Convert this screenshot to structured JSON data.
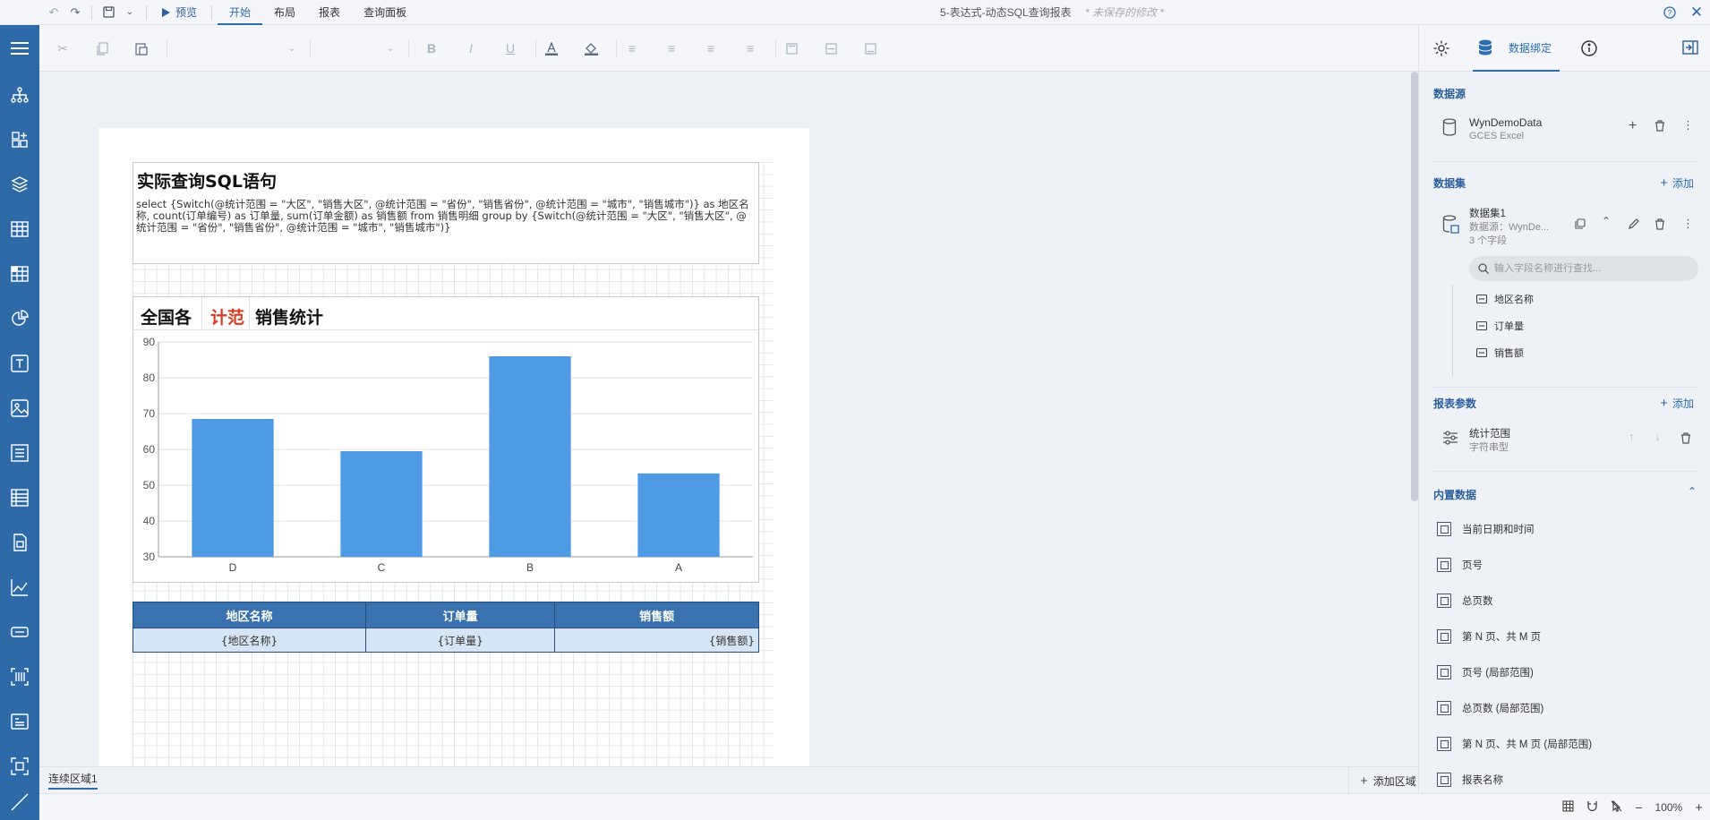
{
  "topbar": {
    "preview_label": "预览",
    "tabs": [
      {
        "label": "开始",
        "active": true
      },
      {
        "label": "布局",
        "active": false
      },
      {
        "label": "报表",
        "active": false
      },
      {
        "label": "查询面板",
        "active": false
      }
    ],
    "doc_title": "5-表达式-动态SQL查询报表",
    "unsaved": "* 未保存的修改 *"
  },
  "sql_box": {
    "title": "实际查询SQL语句",
    "text": "select {Switch(@统计范围 = \"大区\", \"销售大区\", @统计范围 = \"省份\", \"销售省份\", @统计范围 = \"城市\", \"销售城市\")} as 地区名称, count(订单编号) as 订单量, sum(订单金额) as 销售额 from 销售明细 group by {Switch(@统计范围 = \"大区\", \"销售大区\", @统计范围 = \"省份\", \"销售省份\", @统计范围 = \"城市\", \"销售城市\")}"
  },
  "chart_title": {
    "left": "全国各",
    "middle": "计范",
    "right": "销售统计"
  },
  "chart_data": {
    "type": "bar",
    "categories": [
      "D",
      "C",
      "B",
      "A"
    ],
    "values": [
      68.5,
      59.5,
      86,
      53.3
    ],
    "ylim": [
      30,
      90
    ],
    "yticks": [
      30,
      40,
      50,
      60,
      70,
      80,
      90
    ],
    "grid": true,
    "bar_color": "#4f9be3"
  },
  "table": {
    "headers": [
      "地区名称",
      "订单量",
      "销售额"
    ],
    "row": [
      "{地区名称}",
      "{订单量}",
      "{销售额}"
    ]
  },
  "bottombar": {
    "region_tab": "连续区域1",
    "add_region": "添加区域"
  },
  "statusbar": {
    "zoom": "100%"
  },
  "rpanel": {
    "tab_label": "数据绑定",
    "datasource_section": "数据源",
    "datasource_name": "WynDemoData",
    "datasource_type": "GCES Excel",
    "dataset_section": "数据集",
    "add_label": "添加",
    "dataset_name": "数据集1",
    "dataset_source": "数据源：WynDe...",
    "dataset_fields_count": "3 个字段",
    "search_placeholder": "输入字段名称进行查找...",
    "fields": [
      "地区名称",
      "订单量",
      "销售额"
    ],
    "params_section": "报表参数",
    "param_name": "统计范围",
    "param_type": "字符串型",
    "builtin_section": "内置数据",
    "builtin_items": [
      "当前日期和时间",
      "页号",
      "总页数",
      "第 N 页、共 M 页",
      "页号 (局部范围)",
      "总页数 (局部范围)",
      "第 N 页、共 M 页 (局部范围)",
      "报表名称"
    ]
  }
}
